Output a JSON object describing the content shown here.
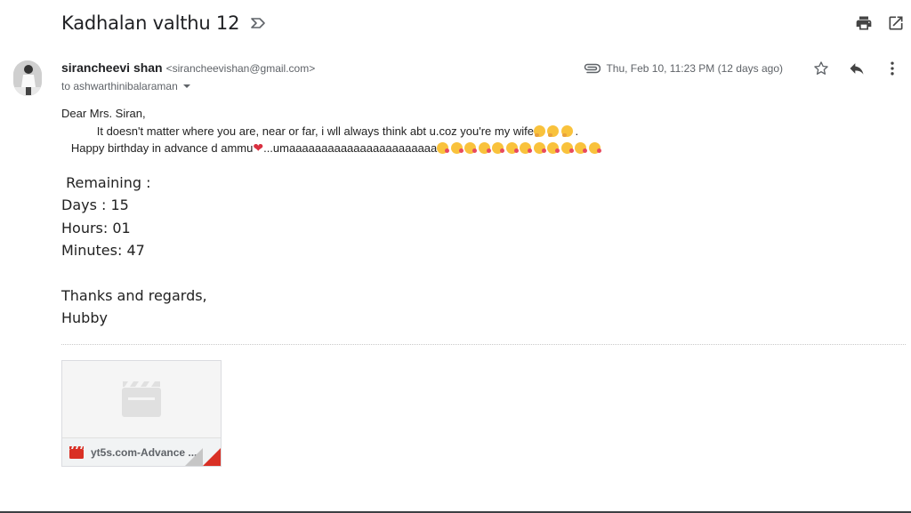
{
  "email": {
    "subject": "Kadhalan valthu 12",
    "sender": {
      "name": "sirancheevi shan",
      "email": "<sirancheevishan@gmail.com>"
    },
    "to": "to ashwarthinibalaraman",
    "date": "Thu, Feb 10, 11:23 PM (12 days ago)",
    "body": {
      "greeting": "Dear Mrs. Siran,",
      "line1": "           It doesn't matter where you are, near or far, i wll always think abt u.coz you're my wife",
      "line1_tail": ".",
      "line2": "   Happy birthday in advance d ammu",
      "heart": "❤",
      "line2_b": "...umaaaaaaaaaaaaaaaaaaaaaaa",
      "remaining": " Remaining :",
      "days": "Days : 15",
      "hours": "Hours: 01",
      "minutes": "Minutes: 47",
      "thanks": "Thanks and regards,",
      "signoff": "Hubby"
    },
    "attachment": {
      "name": "yt5s.com-Advance ..."
    }
  },
  "icons": {
    "importance": "importance-marker-icon",
    "print": "print-icon",
    "open_new": "open-in-new-window-icon",
    "attachment": "paperclip-icon",
    "star": "star-icon",
    "reply": "reply-icon",
    "more": "more-vert-icon",
    "video": "video-file-icon"
  },
  "colors": {
    "text": "#202124",
    "muted": "#5f6368",
    "attachment_accent": "#d93025",
    "heart": "#d93040"
  }
}
